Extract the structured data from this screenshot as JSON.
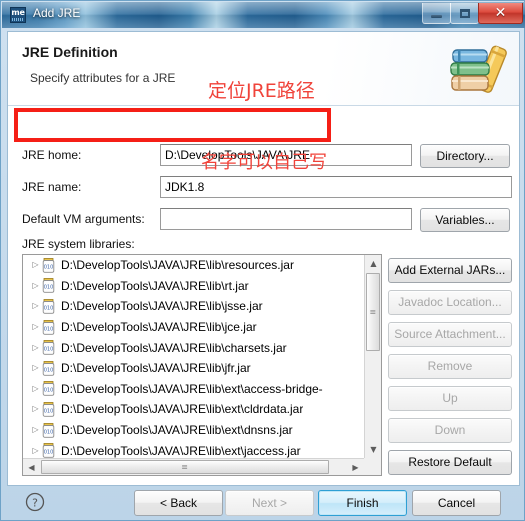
{
  "window": {
    "title": "Add JRE",
    "icon": "me-app-icon",
    "controls": {
      "minimize": "minimize-button",
      "maximize": "maximize-button",
      "close": "close-button",
      "close_glyph": "✕"
    }
  },
  "header": {
    "title": "JRE Definition",
    "subtitle": "Specify attributes for a JRE",
    "icon": "books-stack-icon"
  },
  "form": {
    "jre_home": {
      "label": "JRE home:",
      "value": "D:\\DevelopTools\\JAVA\\JRE",
      "placeholder": "",
      "button": "Directory..."
    },
    "jre_name": {
      "label": "JRE name:",
      "value": "JDK1.8",
      "placeholder": ""
    },
    "vm_args": {
      "label": "Default VM arguments:",
      "value": "",
      "placeholder": "",
      "button": "Variables..."
    },
    "libraries_label": "JRE system libraries:"
  },
  "libraries": [
    {
      "path": "D:\\DevelopTools\\JAVA\\JRE\\lib\\resources.jar"
    },
    {
      "path": "D:\\DevelopTools\\JAVA\\JRE\\lib\\rt.jar"
    },
    {
      "path": "D:\\DevelopTools\\JAVA\\JRE\\lib\\jsse.jar"
    },
    {
      "path": "D:\\DevelopTools\\JAVA\\JRE\\lib\\jce.jar"
    },
    {
      "path": "D:\\DevelopTools\\JAVA\\JRE\\lib\\charsets.jar"
    },
    {
      "path": "D:\\DevelopTools\\JAVA\\JRE\\lib\\jfr.jar"
    },
    {
      "path": "D:\\DevelopTools\\JAVA\\JRE\\lib\\ext\\access-bridge-"
    },
    {
      "path": "D:\\DevelopTools\\JAVA\\JRE\\lib\\ext\\cldrdata.jar"
    },
    {
      "path": "D:\\DevelopTools\\JAVA\\JRE\\lib\\ext\\dnsns.jar"
    },
    {
      "path": "D:\\DevelopTools\\JAVA\\JRE\\lib\\ext\\jaccess.jar"
    }
  ],
  "side_buttons": [
    {
      "label": "Add External JARs...",
      "enabled": true
    },
    {
      "label": "Javadoc Location...",
      "enabled": false
    },
    {
      "label": "Source Attachment...",
      "enabled": false
    },
    {
      "label": "Remove",
      "enabled": false
    },
    {
      "label": "Up",
      "enabled": false
    },
    {
      "label": "Down",
      "enabled": false
    },
    {
      "label": "Restore Default",
      "enabled": true
    }
  ],
  "wizard_buttons": {
    "help": "?",
    "back": "< Back",
    "next": "Next >",
    "finish": "Finish",
    "cancel": "Cancel"
  },
  "annotations": [
    {
      "text": "定位JRE路径",
      "color": "#f0433a"
    },
    {
      "text": "名字可以自己写",
      "color": "#f0433a"
    }
  ],
  "colors": {
    "annotation_red": "#f51f16",
    "title_blue": "#2a6a9d",
    "default_button_blue": "#2f9fd4"
  },
  "scrollbars": {
    "v_up": "▲",
    "v_down": "▼",
    "h_left": "◀",
    "h_right": "▶",
    "grip": "≡"
  }
}
